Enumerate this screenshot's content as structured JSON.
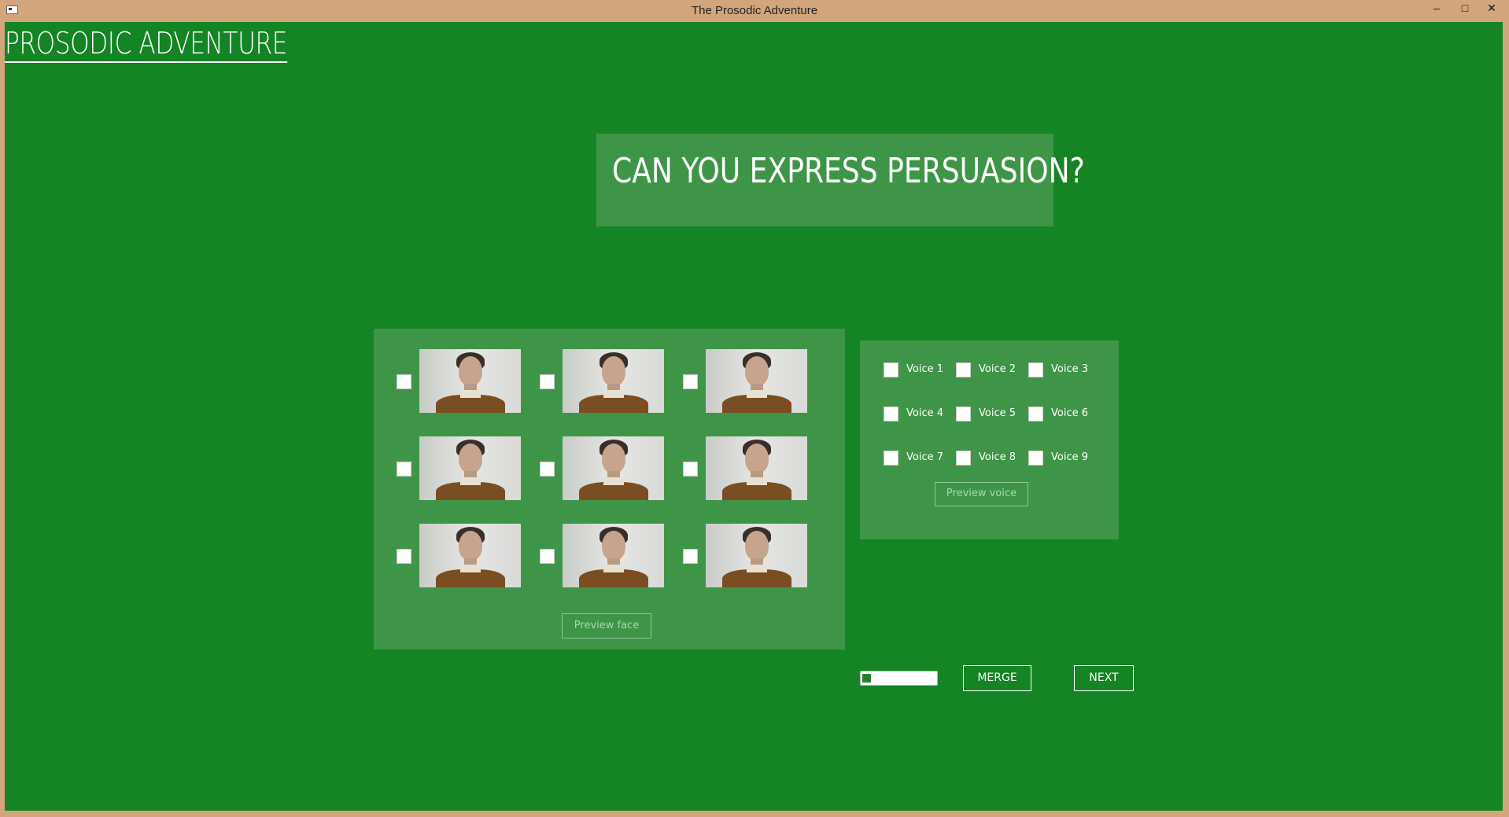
{
  "window": {
    "title": "The Prosodic Adventure",
    "min_label": "–",
    "max_label": "□",
    "close_label": "✕"
  },
  "app": {
    "title": "PROSODIC ADVENTURE"
  },
  "banner": {
    "text": "CAN YOU EXPRESS PERSUASION?"
  },
  "faces": {
    "items": [
      {
        "checked": false
      },
      {
        "checked": false
      },
      {
        "checked": false
      },
      {
        "checked": false
      },
      {
        "checked": false
      },
      {
        "checked": false
      },
      {
        "checked": false
      },
      {
        "checked": false
      },
      {
        "checked": false
      }
    ],
    "preview_label": "Preview face"
  },
  "voices": {
    "items": [
      {
        "label": "Voice 1",
        "checked": false
      },
      {
        "label": "Voice 2",
        "checked": false
      },
      {
        "label": "Voice 3",
        "checked": false
      },
      {
        "label": "Voice 4",
        "checked": false
      },
      {
        "label": "Voice 5",
        "checked": false
      },
      {
        "label": "Voice 6",
        "checked": false
      },
      {
        "label": "Voice 7",
        "checked": false
      },
      {
        "label": "Voice 8",
        "checked": false
      },
      {
        "label": "Voice 9",
        "checked": false
      }
    ],
    "preview_label": "Preview voice"
  },
  "progress": {
    "fraction": 0.12
  },
  "buttons": {
    "merge_label": "MERGE",
    "next_label": "NEXT"
  },
  "colors": {
    "background": "#148424",
    "panel": "#3e9548",
    "frame": "#d3a57c"
  }
}
